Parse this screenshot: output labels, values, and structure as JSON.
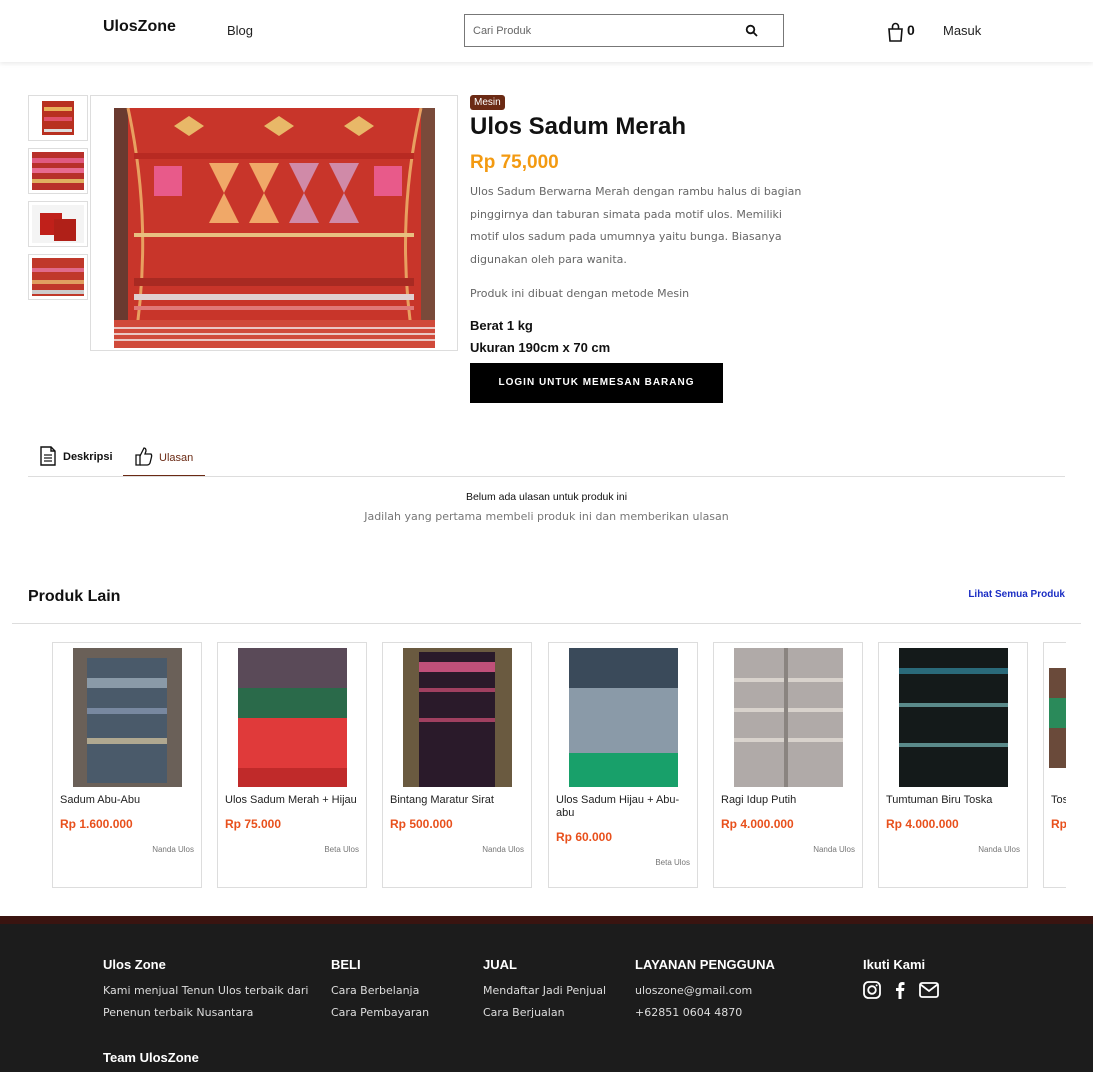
{
  "header": {
    "logo": "UlosZone",
    "nav_blog": "Blog",
    "search_placeholder": "Cari Produk",
    "cart_count": "0",
    "login": "Masuk"
  },
  "product": {
    "badge": "Mesin",
    "title": "Ulos Sadum Merah",
    "price": "Rp 75,000",
    "description": "Ulos Sadum Berwarna Merah dengan rambu halus di bagian pinggirnya dan taburan simata pada motif ulos. Memiliki motif ulos sadum pada umumnya yaitu bunga. Biasanya digunakan oleh para wanita.",
    "method": "Produk ini dibuat dengan metode Mesin",
    "weight": "Berat 1 kg",
    "size": "Ukuran 190cm x 70 cm",
    "order_button": "LOGIN UNTUK MEMESAN BARANG"
  },
  "tabs": {
    "description": "Deskripsi",
    "reviews": "Ulasan"
  },
  "reviews": {
    "empty_title": "Belum ada ulasan untuk produk ini",
    "empty_subtitle": "Jadilah yang pertama membeli produk ini dan memberikan ulasan"
  },
  "other_products": {
    "title": "Produk Lain",
    "see_all": "Lihat Semua Produk",
    "items": [
      {
        "name": "Sadum Abu-Abu",
        "price": "Rp 1.600.000",
        "shop": "Nanda Ulos"
      },
      {
        "name": "Ulos Sadum Merah + Hijau",
        "price": "Rp 75.000",
        "shop": "Beta Ulos"
      },
      {
        "name": "Bintang Maratur Sirat",
        "price": "Rp 500.000",
        "shop": "Nanda Ulos"
      },
      {
        "name": "Ulos Sadum Hijau + Abu-abu",
        "price": "Rp 60.000",
        "shop": "Beta Ulos"
      },
      {
        "name": "Ragi Idup Putih",
        "price": "Rp 4.000.000",
        "shop": "Nanda Ulos"
      },
      {
        "name": "Tumtuman Biru Toska",
        "price": "Rp 4.000.000",
        "shop": "Nanda Ulos"
      },
      {
        "name": "Tos",
        "price": "Rp",
        "shop": ""
      }
    ]
  },
  "footer": {
    "about_title": "Ulos Zone",
    "about_line1": "Kami menjual Tenun Ulos terbaik dari",
    "about_line2": "Penenun terbaik Nusantara",
    "buy_title": "BELI",
    "buy_link1": "Cara Berbelanja",
    "buy_link2": "Cara Pembayaran",
    "sell_title": "JUAL",
    "sell_link1": "Mendaftar Jadi Penjual",
    "sell_link2": "Cara Berjualan",
    "service_title": "LAYANAN PENGGUNA",
    "service_email": "uloszone@gmail.com",
    "service_phone": "+62851 0604 4870",
    "follow_title": "Ikuti Kami",
    "team": "Team UlosZone"
  },
  "colors": {
    "accent_orange": "#f39a11",
    "price_red": "#e8501c",
    "badge_brown": "#6b2a14",
    "link_blue": "#1b2ec4",
    "footer_bg": "#1c1c1c"
  },
  "icons": [
    "search-icon",
    "cart-icon",
    "document-icon",
    "thumbs-up-icon",
    "instagram-icon",
    "facebook-icon",
    "mail-icon"
  ]
}
